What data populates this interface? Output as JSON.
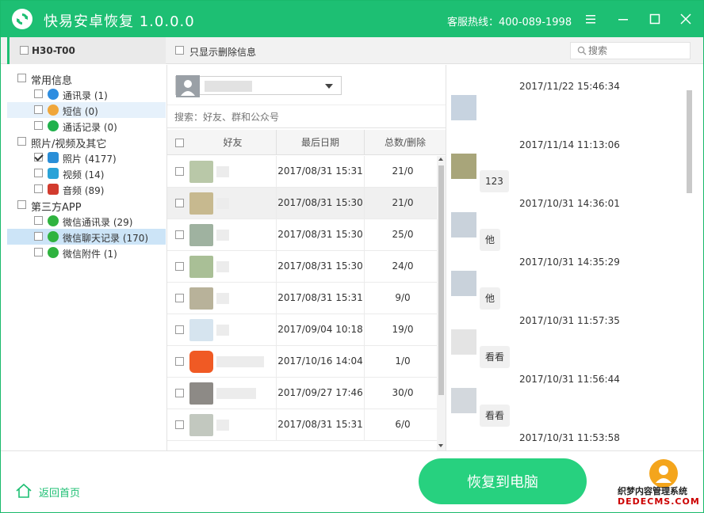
{
  "app": {
    "title": "快易安卓恢复  1.0.0.0",
    "hotline": "客服热线：400-089-1998"
  },
  "toolbar": {
    "device_name": "H30-T00",
    "only_deleted_label": "只显示删除信息",
    "search_placeholder": "搜索"
  },
  "tree": {
    "categories": [
      {
        "label": "常用信息"
      },
      {
        "label": "照片/视频及其它"
      },
      {
        "label": "第三方APP"
      }
    ],
    "items": [
      {
        "label": "通讯录 (1)",
        "icon": "contacts-icon",
        "color": "#2e8de0"
      },
      {
        "label": "短信 (0)",
        "icon": "sms-icon",
        "color": "#f0a63a"
      },
      {
        "label": "通话记录 (0)",
        "icon": "phone-icon",
        "color": "#21b14c"
      },
      {
        "label": "照片 (4177)",
        "icon": "photo-icon",
        "color": "#2a8fd8"
      },
      {
        "label": "视频 (14)",
        "icon": "video-icon",
        "color": "#2aa3d8"
      },
      {
        "label": "音频 (89)",
        "icon": "audio-icon",
        "color": "#d23b2e"
      },
      {
        "label": "微信通讯录 (29)",
        "icon": "wechat-icon",
        "color": "#2fb33f"
      },
      {
        "label": "微信聊天记录 (170)",
        "icon": "wechat-icon",
        "color": "#2fb33f"
      },
      {
        "label": "微信附件 (1)",
        "icon": "wechat-icon",
        "color": "#2fb33f"
      }
    ]
  },
  "middle": {
    "friend_search_placeholder": "搜索：好友、群和公众号",
    "columns": [
      "好友",
      "最后日期",
      "总数/删除"
    ],
    "rows": [
      {
        "date": "2017/08/31 15:31",
        "count": "21/0"
      },
      {
        "date": "2017/08/31 15:30",
        "count": "21/0"
      },
      {
        "date": "2017/08/31 15:30",
        "count": "25/0"
      },
      {
        "date": "2017/08/31 15:30",
        "count": "24/0"
      },
      {
        "date": "2017/08/31 15:31",
        "count": "9/0"
      },
      {
        "date": "2017/09/04 10:18",
        "count": "19/0"
      },
      {
        "date": "2017/10/16 14:04",
        "count": "1/0"
      },
      {
        "date": "2017/09/27 17:46",
        "count": "30/0"
      },
      {
        "date": "2017/08/31 15:31",
        "count": "6/0"
      }
    ]
  },
  "chat": {
    "messages": [
      {
        "time": "2017/11/22 15:46:34",
        "text": ""
      },
      {
        "time": "2017/11/14 11:13:06",
        "text": "123"
      },
      {
        "time": "2017/10/31 14:36:01",
        "text": "他"
      },
      {
        "time": "2017/10/31 14:35:29",
        "text": "他"
      },
      {
        "time": "2017/10/31 11:57:35",
        "text": "看看"
      },
      {
        "time": "2017/10/31 11:56:44",
        "text": "看看"
      },
      {
        "time": "2017/10/31 11:53:58",
        "text": ""
      }
    ]
  },
  "bottom": {
    "home_label": "返回首页",
    "recover_label": "恢复到电脑",
    "watermark_line1": "织梦内容管理系统",
    "watermark_line2": "DEDECMS.COM"
  },
  "colors": {
    "brand": "#1dbf73",
    "button": "#27d17f",
    "service": "#f4a51c"
  }
}
